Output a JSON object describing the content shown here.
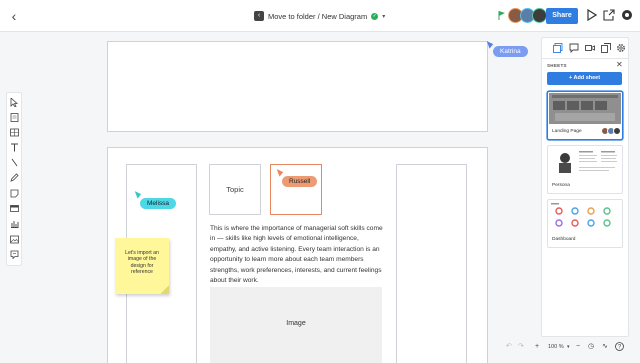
{
  "header": {
    "breadcrumb": "Move to folder / New Diagram",
    "share_label": "Share"
  },
  "canvas": {
    "topic_label": "Topic",
    "body_text": "This is where the importance of managerial soft skills come in — skills like high levels of emotional intelligence, empathy, and active listening. Every team interaction is an opportunity to learn more about each team members strengths, work preferences, interests, and current feelings about their work.",
    "image_label": "Image",
    "sticky_note": "Let's import an image of the design for reference"
  },
  "collaborators": {
    "melissa": "Melissa",
    "russell": "Russell",
    "katrina": "Katrina"
  },
  "colors": {
    "accent": "#2f7de1",
    "melissa": "#4dd8e8",
    "russell": "#ed9b73",
    "katrina": "#7b9cf0",
    "sticky": "#fff79a"
  },
  "sheets_panel": {
    "title": "SHEETS",
    "add_sheet_label": "+ Add sheet",
    "sheets": [
      {
        "label": "Landing Page",
        "selected": true
      },
      {
        "label": "Persona",
        "selected": false
      },
      {
        "label": "Dashboard",
        "selected": false
      }
    ]
  },
  "footer": {
    "zoom": "100 %"
  },
  "icons": [
    "back-icon",
    "document-icon",
    "check-icon",
    "caret-down-icon",
    "flag-icon",
    "play-icon",
    "export-icon",
    "settings-icon",
    "pointer-icon",
    "comment-icon",
    "video-icon",
    "copy-icon",
    "gear-icon",
    "close-icon",
    "undo-icon",
    "redo-icon",
    "history-icon",
    "pulse-icon",
    "help-icon"
  ]
}
